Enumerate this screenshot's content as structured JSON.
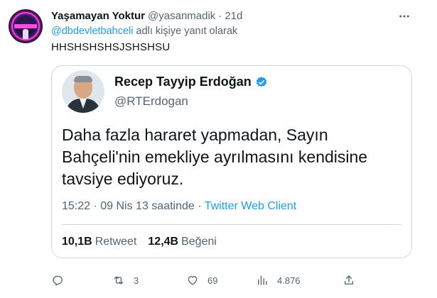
{
  "tweet": {
    "author_name": "Yaşamayan Yoktur",
    "handle": "@yasanmadik",
    "separator": "·",
    "time": "21d",
    "reply_mention": "@dbdevletbahceli",
    "reply_suffix": " adlı kişiye yanıt olarak",
    "text": "HHSHSHSHSJSHSHSU",
    "actions": {
      "reply_count": "",
      "retweet_count": "3",
      "like_count": "69",
      "views_count": "4.876"
    }
  },
  "quoted": {
    "author_name": "Recep Tayyip Erdoğan",
    "handle": "@RTErdogan",
    "text": "Daha fazla hararet yapmadan, Sayın Bahçeli'nin emekliye ayrılmasını kendisine tavsiye ediyoruz.",
    "datetime": "15:22 · 09 Nis 13 saatinde ·",
    "client": "Twitter Web Client",
    "retweets_value": "10,1B",
    "retweets_label": "Retweet",
    "likes_value": "12,4B",
    "likes_label": "Beğeni"
  },
  "colors": {
    "accent": "#1d9bf0",
    "text_primary": "#0f1419",
    "text_secondary": "#536471",
    "border": "#cfd9de"
  },
  "icons": [
    "more-icon",
    "verified-badge-icon",
    "reply-icon",
    "retweet-icon",
    "like-icon",
    "views-icon",
    "share-icon"
  ]
}
